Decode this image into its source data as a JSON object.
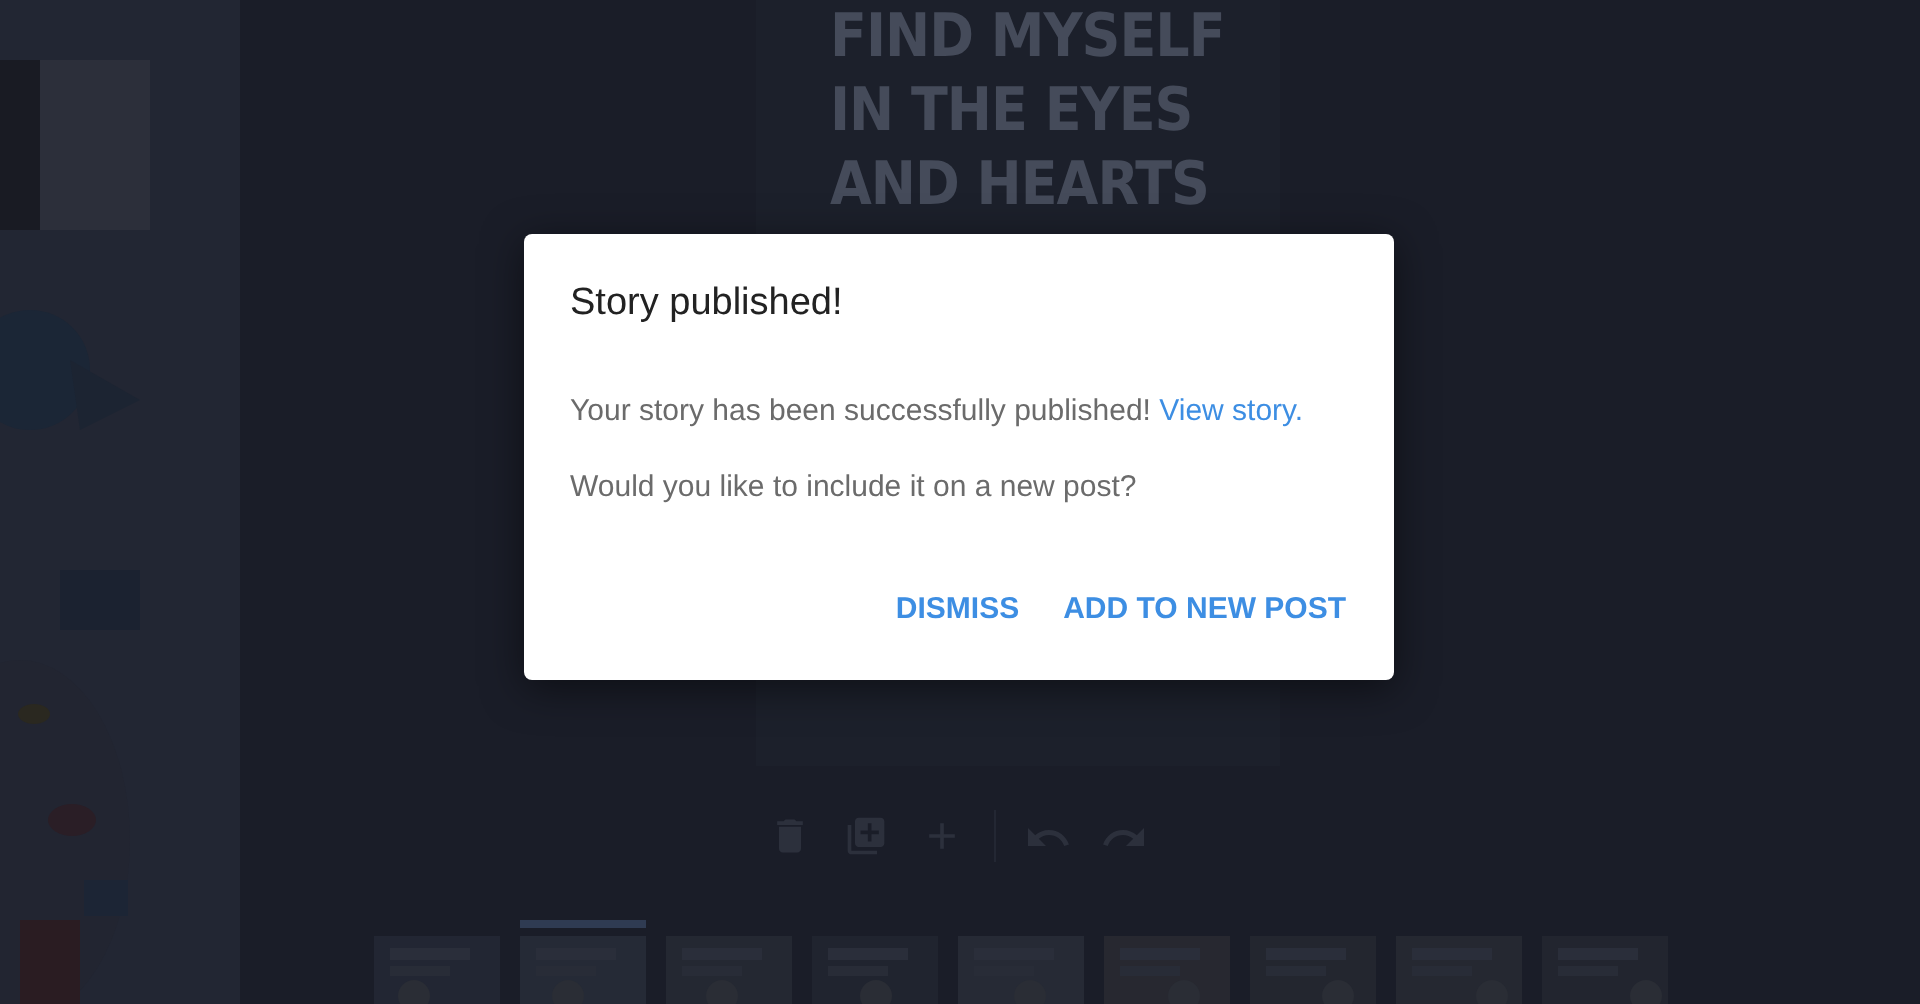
{
  "slide": {
    "text_lines": [
      "FIND MYSELF",
      "IN THE EYES",
      "AND HEARTS"
    ]
  },
  "toolbar": {
    "buttons": [
      {
        "kind": "delete"
      },
      {
        "kind": "duplicate"
      },
      {
        "kind": "add"
      },
      {
        "kind": "undo"
      },
      {
        "kind": "redo"
      }
    ]
  },
  "thumbnails": [
    {
      "selected": false
    },
    {
      "selected": true
    },
    {
      "selected": false
    },
    {
      "selected": false
    },
    {
      "selected": false
    },
    {
      "selected": false
    },
    {
      "selected": false
    },
    {
      "selected": false
    },
    {
      "selected": false
    }
  ],
  "dialog": {
    "title": "Story published!",
    "message": "Your story has been successfully published!",
    "link": "View story.",
    "question": "Would you like to include it on a new post?",
    "buttons": [
      "DISMISS",
      "ADD TO NEW POST"
    ]
  }
}
